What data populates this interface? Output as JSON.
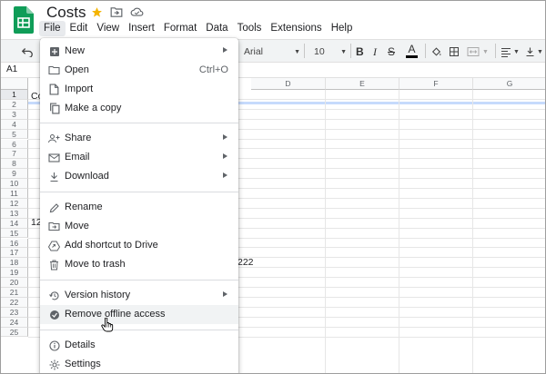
{
  "app": {
    "doc_title": "Costs"
  },
  "menubar": [
    "File",
    "Edit",
    "View",
    "Insert",
    "Format",
    "Data",
    "Tools",
    "Extensions",
    "Help"
  ],
  "toolbar": {
    "font": "Arial",
    "font_size": "10"
  },
  "formula_bar": {
    "cell_ref": "A1"
  },
  "grid": {
    "columns": [
      "D",
      "E",
      "F",
      "G"
    ],
    "rows": [
      "1",
      "2",
      "3",
      "4",
      "5",
      "6",
      "7",
      "8",
      "9",
      "10",
      "11",
      "12",
      "13",
      "14",
      "15",
      "16",
      "17",
      "18",
      "19",
      "20",
      "21",
      "22",
      "23",
      "24",
      "25"
    ],
    "visible_cells": {
      "a1": "Co",
      "a13": "12",
      "c17": "222"
    }
  },
  "file_menu": {
    "items": [
      {
        "label": "New",
        "icon": "plus-box-icon",
        "submenu": true
      },
      {
        "label": "Open",
        "icon": "folder-icon",
        "shortcut": "Ctrl+O"
      },
      {
        "label": "Import",
        "icon": "document-icon"
      },
      {
        "label": "Make a copy",
        "icon": "copy-icon"
      },
      {
        "label": "Share",
        "icon": "person-add-icon",
        "submenu": true
      },
      {
        "label": "Email",
        "icon": "envelope-icon",
        "submenu": true
      },
      {
        "label": "Download",
        "icon": "download-icon",
        "submenu": true
      },
      {
        "label": "Rename",
        "icon": "pencil-icon"
      },
      {
        "label": "Move",
        "icon": "folder-move-icon"
      },
      {
        "label": "Add shortcut to Drive",
        "icon": "drive-shortcut-icon"
      },
      {
        "label": "Move to trash",
        "icon": "trash-icon"
      },
      {
        "label": "Version history",
        "icon": "history-icon",
        "submenu": true
      },
      {
        "label": "Remove offline access",
        "icon": "offline-check-icon",
        "highlighted": true
      },
      {
        "label": "Details",
        "icon": "info-icon"
      },
      {
        "label": "Settings",
        "icon": "gear-icon"
      }
    ]
  },
  "colors": {
    "sheets_green": "#0f9d58",
    "star": "#f4b400",
    "hover_bg": "#f1f3f4",
    "selection": "#c6dafc"
  }
}
